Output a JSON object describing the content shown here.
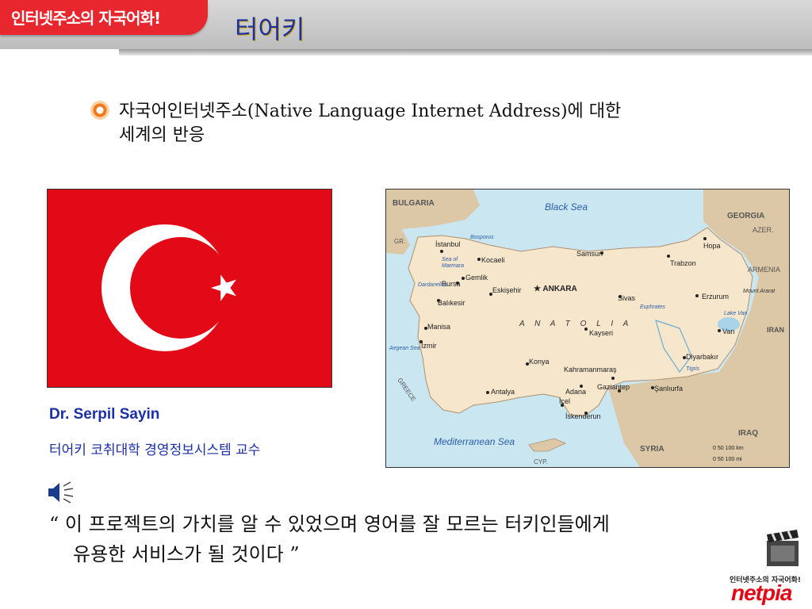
{
  "header": {
    "badge_text": "인터넷주소의 자국어화!",
    "title": "터어키"
  },
  "bullet": {
    "line1": "자국어인터넷주소(Native Language Internet Address)에 대한",
    "line2": "세계의 반응"
  },
  "profile": {
    "name": "Dr. Serpil Sayin",
    "title": "터어키 코취대학 경영정보시스템 교수"
  },
  "quote": {
    "line1": "“ 이 프로젝트의 가치를 알 수 있었으며 영어를 잘 모르는 터키인들에게",
    "line2": "유용한 서비스가 될 것이다 ”"
  },
  "map": {
    "countries": [
      "BULGARIA",
      "GEORGIA",
      "AZER.",
      "ARMENIA",
      "IRAN",
      "IRAQ",
      "SYRIA",
      "CYP.",
      "GR."
    ],
    "seas": [
      "Black Sea",
      "Mediterranean Sea"
    ],
    "region": "A N A T O L I A",
    "greece_label": "GREECE",
    "cities": [
      "Istanbul",
      "Kocaeli",
      "Gemlik",
      "Bursa",
      "Balıkesir",
      "Eskişehir",
      "ANKARA",
      "Samsun",
      "Hopa",
      "Trabzon",
      "Sivas",
      "Erzurum",
      "Van",
      "Manisa",
      "İzmir",
      "Kayseri",
      "Konya",
      "Kahramanmaraş",
      "Diyarbakır",
      "Adana",
      "Gaziantep",
      "Şanlıurfa",
      "İçel",
      "İskenderun",
      "Antalya"
    ],
    "water": [
      "Bosporus",
      "Sea of Marmara",
      "Dardanelles",
      "Euphrates",
      "Tigris",
      "Lake Van",
      "Aegean Sea"
    ],
    "mountain": "Mount Ararat",
    "scale_km": "0    50   100 km",
    "scale_mi": "0    50   100 mi"
  },
  "footer": {
    "logo_small": "인터넷주소의 자국어화!",
    "logo_brand": "netpia"
  },
  "colors": {
    "badge_red": "#e8262d",
    "title_blue": "#1a2fa8",
    "flag_red": "#e30a17",
    "land": "#f6e6cc",
    "water": "#c9e6f1",
    "neighbor": "#dcc8a6"
  }
}
